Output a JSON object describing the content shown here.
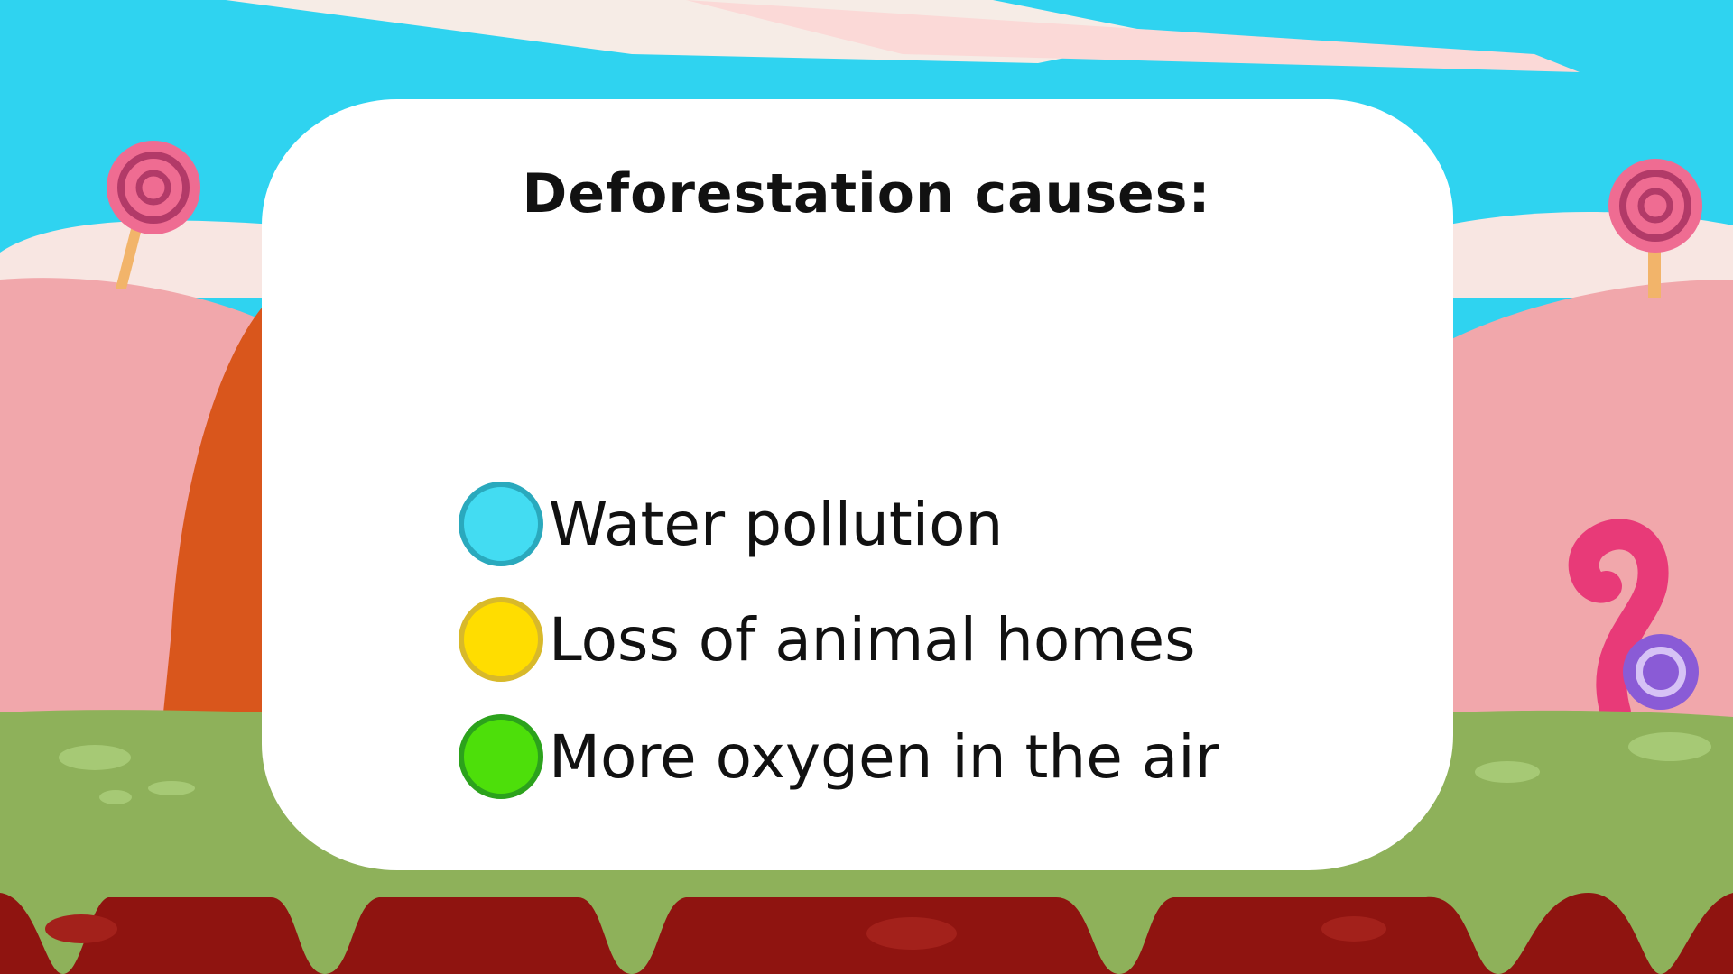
{
  "question": {
    "text": "Deforestation causes:"
  },
  "options": [
    {
      "label": "Water pollution",
      "color": "#43dcf2",
      "border": "#2aa9bd"
    },
    {
      "label": "Loss of animal homes",
      "color": "#ffdd00",
      "border": "#d8b92a"
    },
    {
      "label": "More oxygen in the air",
      "color": "#4ddf0a",
      "border": "#2ca21c"
    }
  ],
  "colors": {
    "sky": "#2fd3f0",
    "hills": "#f0a9ad",
    "grass": "#8eb15a",
    "dirt": "#8f1410",
    "card": "#ffffff"
  }
}
